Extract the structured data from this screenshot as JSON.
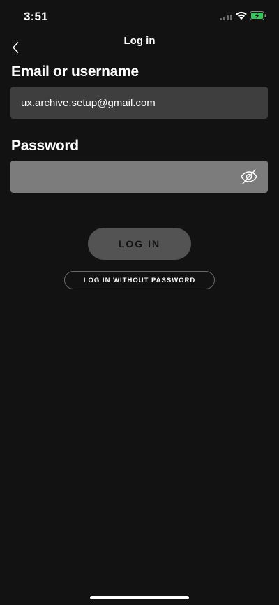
{
  "status_bar": {
    "time": "3:51",
    "icons": [
      "signal-icon",
      "wifi-icon",
      "battery-charging-icon"
    ],
    "battery_color": "#34c759"
  },
  "header": {
    "title": "Log in",
    "back_icon": "chevron-left-icon"
  },
  "form": {
    "email": {
      "label": "Email or username",
      "value": "ux.archive.setup@gmail.com"
    },
    "password": {
      "label": "Password",
      "value": "",
      "toggle_icon": "eye-slash-icon"
    },
    "login_button_label": "LOG IN",
    "passwordless_button_label": "LOG IN WITHOUT PASSWORD"
  },
  "colors": {
    "background": "#121212",
    "email_field": "#3e3e3e",
    "password_field": "#7c7c7c",
    "login_button": "#535353"
  }
}
